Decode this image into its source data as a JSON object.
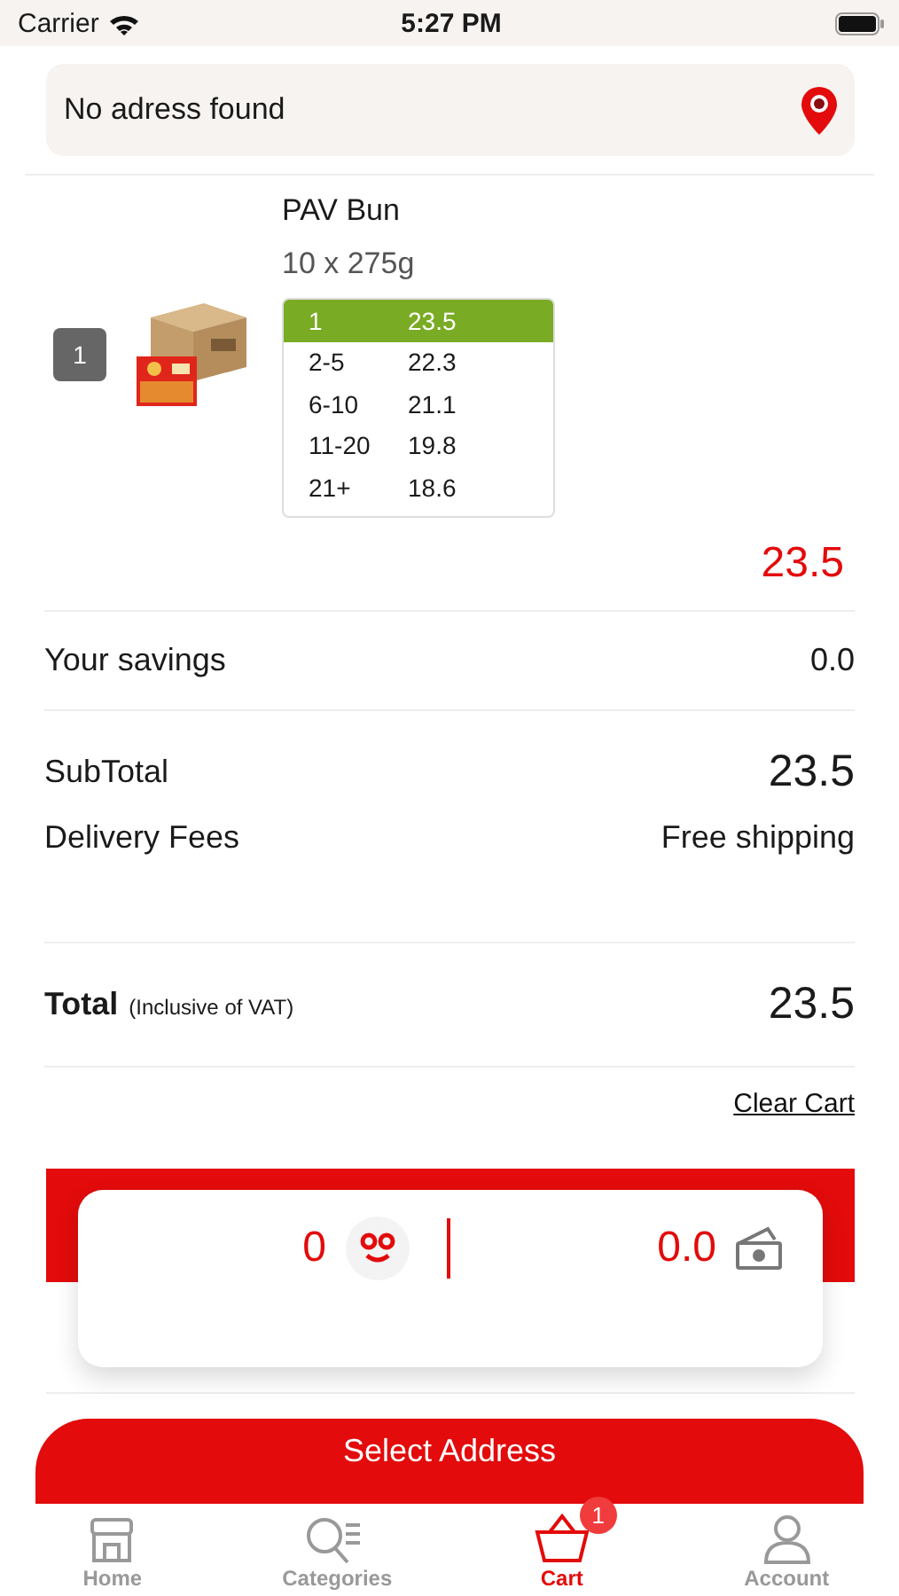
{
  "status_bar": {
    "carrier": "Carrier",
    "time": "5:27 PM"
  },
  "address": {
    "text": "No adress found"
  },
  "item": {
    "name": "PAV Bun",
    "pack": "10 x 275g",
    "quantity": "1",
    "price": "23.5",
    "tiers": [
      {
        "range": "1",
        "price": "23.5",
        "selected": true
      },
      {
        "range": "2-5",
        "price": "22.3",
        "selected": false
      },
      {
        "range": "6-10",
        "price": "21.1",
        "selected": false
      },
      {
        "range": "11-20",
        "price": "19.8",
        "selected": false
      },
      {
        "range": "21+",
        "price": "18.6",
        "selected": false
      }
    ]
  },
  "savings": {
    "label": "Your savings",
    "value": "0.0"
  },
  "subtotal": {
    "label": "SubTotal",
    "value": "23.5"
  },
  "delivery": {
    "label": "Delivery Fees",
    "value": "Free shipping"
  },
  "total": {
    "label": "Total",
    "note": "(Inclusive of VAT)",
    "value": "23.5"
  },
  "clear_cart": "Clear Cart",
  "loyalty": {
    "points": "0",
    "cash": "0.0"
  },
  "checkout_button": "Select Address",
  "tabs": [
    {
      "label": "Home",
      "selected": false
    },
    {
      "label": "Categories",
      "selected": false
    },
    {
      "label": "Cart",
      "selected": true,
      "badge": "1"
    },
    {
      "label": "Account",
      "selected": false
    }
  ]
}
